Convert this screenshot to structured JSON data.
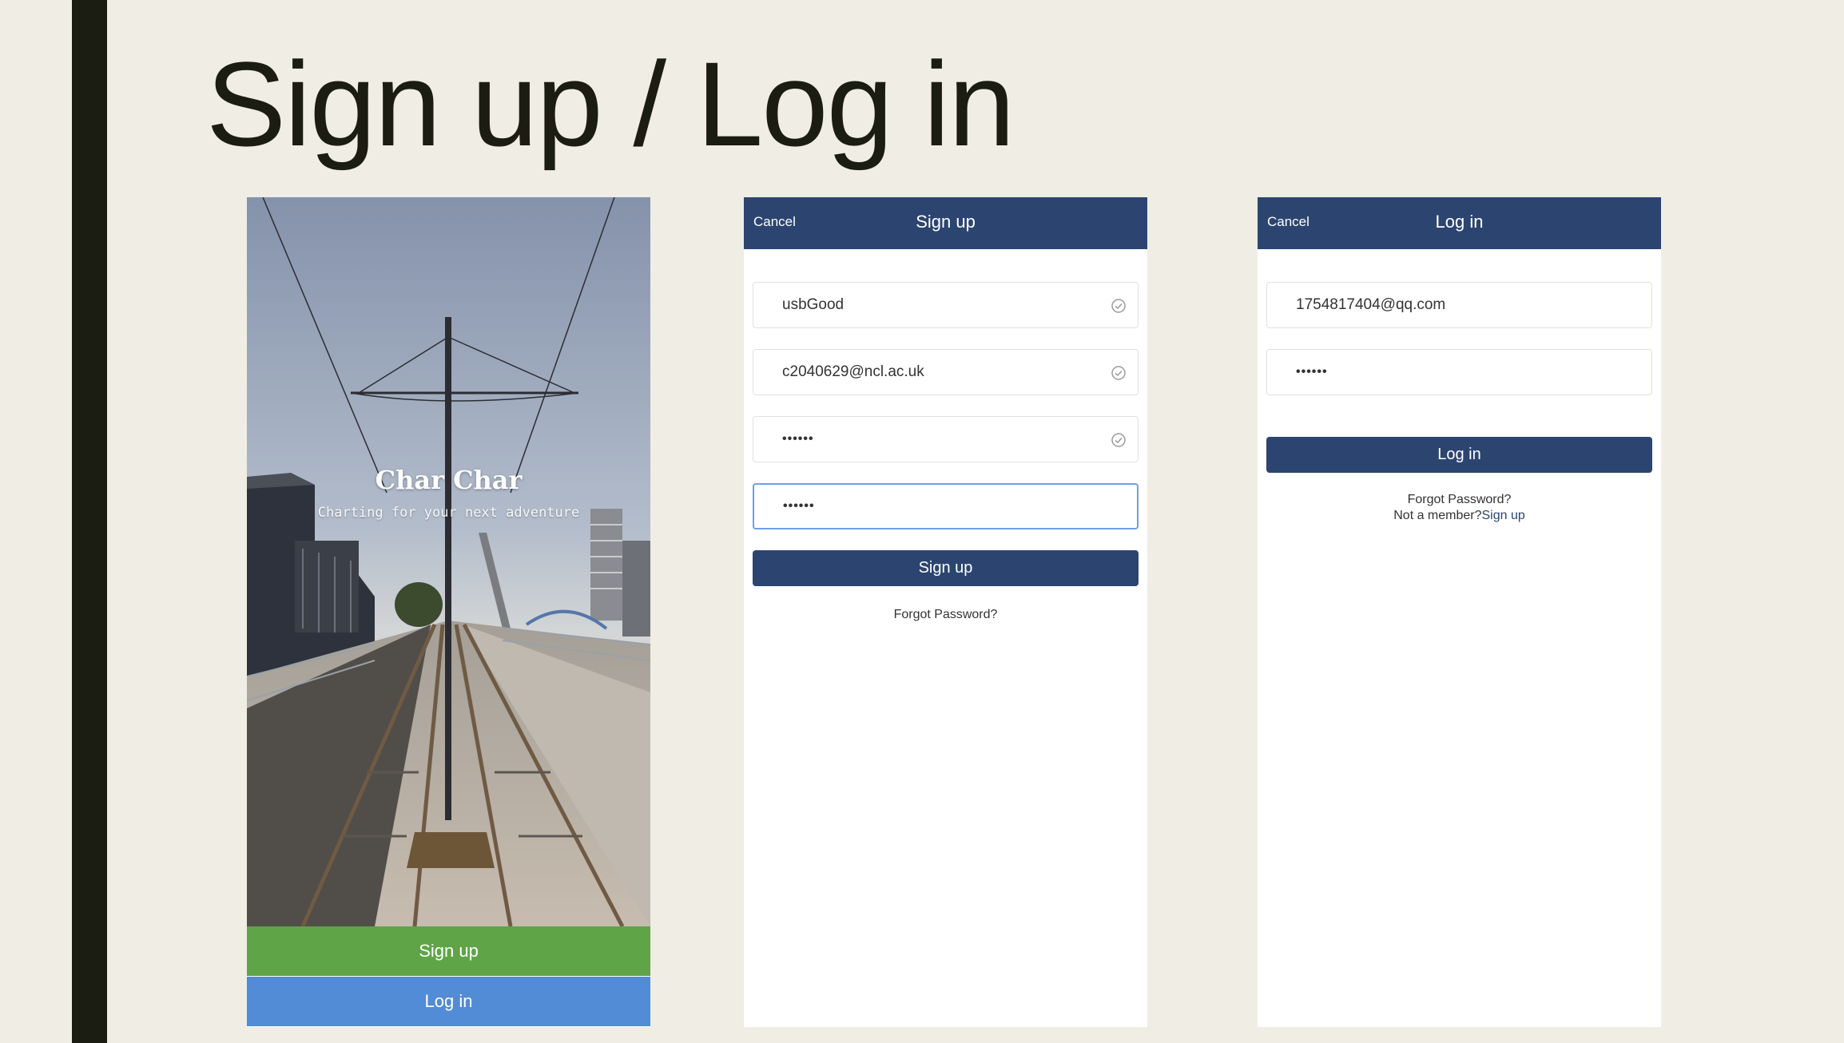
{
  "slide": {
    "title": "Sign up / Log in"
  },
  "welcome": {
    "app_name": "Char Char",
    "tagline": "Charting for your next adventure",
    "signup_label": "Sign up",
    "login_label": "Log in",
    "signup_color": "#5fa447",
    "login_color": "#528bd6"
  },
  "signup": {
    "cancel": "Cancel",
    "title": "Sign up",
    "username": "usbGood",
    "email": "c2040629@ncl.ac.uk",
    "password": "••••••",
    "confirm_password": "••••••",
    "submit": "Sign up",
    "forgot": "Forgot Password?",
    "validated_icon": "check-circle-icon"
  },
  "login": {
    "cancel": "Cancel",
    "title": "Log in",
    "email": "1754817404@qq.com",
    "password": "••••••",
    "submit": "Log in",
    "forgot": "Forgot Password?",
    "not_member": "Not a member?",
    "signup_link": "Sign up"
  },
  "colors": {
    "nav": "#2c4570",
    "focus_border": "#6e9fe8",
    "background": "#efede4",
    "accent_bar": "#1b1c12"
  }
}
